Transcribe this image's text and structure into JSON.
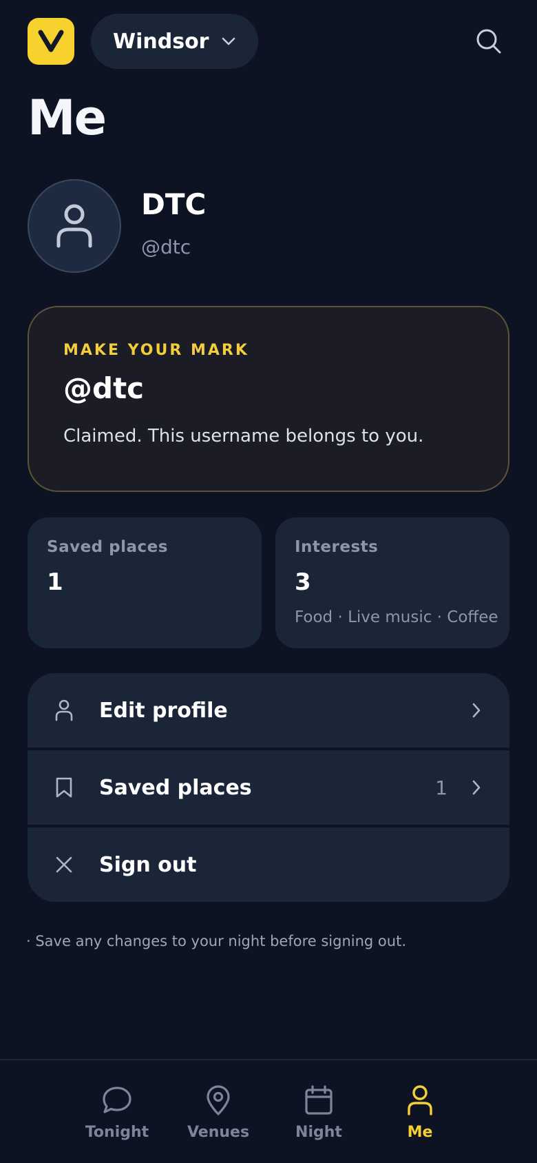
{
  "header": {
    "logo_letter": "V",
    "city": "Windsor"
  },
  "page_title": "Me",
  "profile": {
    "name": "DTC",
    "handle": "@dtc"
  },
  "mark_card": {
    "eyebrow": "MAKE YOUR MARK",
    "handle": "@dtc",
    "text": "Claimed. This username belongs to you."
  },
  "stats": [
    {
      "label": "Saved places",
      "value": "1",
      "sub": ""
    },
    {
      "label": "Interests",
      "value": "3",
      "sub": "Food · Live music · Coffee"
    }
  ],
  "menu": [
    {
      "label": "Edit profile",
      "icon": "person-icon",
      "count": ""
    },
    {
      "label": "Saved places",
      "icon": "bookmark-icon",
      "count": "1"
    },
    {
      "label": "Sign out",
      "icon": "close-icon",
      "count": ""
    }
  ],
  "footnote": "· Save any changes to your night before signing out.",
  "bottom_nav": [
    {
      "label": "Tonight",
      "icon": "chat-bubble-icon",
      "active": false
    },
    {
      "label": "Venues",
      "icon": "map-pin-icon",
      "active": false
    },
    {
      "label": "Night",
      "icon": "calendar-icon",
      "active": false
    },
    {
      "label": "Me",
      "icon": "person-icon",
      "active": true
    }
  ],
  "colors": {
    "background": "#0d1322",
    "card": "#1b2538",
    "accent": "#f5d033",
    "muted": "#8d96aa"
  }
}
